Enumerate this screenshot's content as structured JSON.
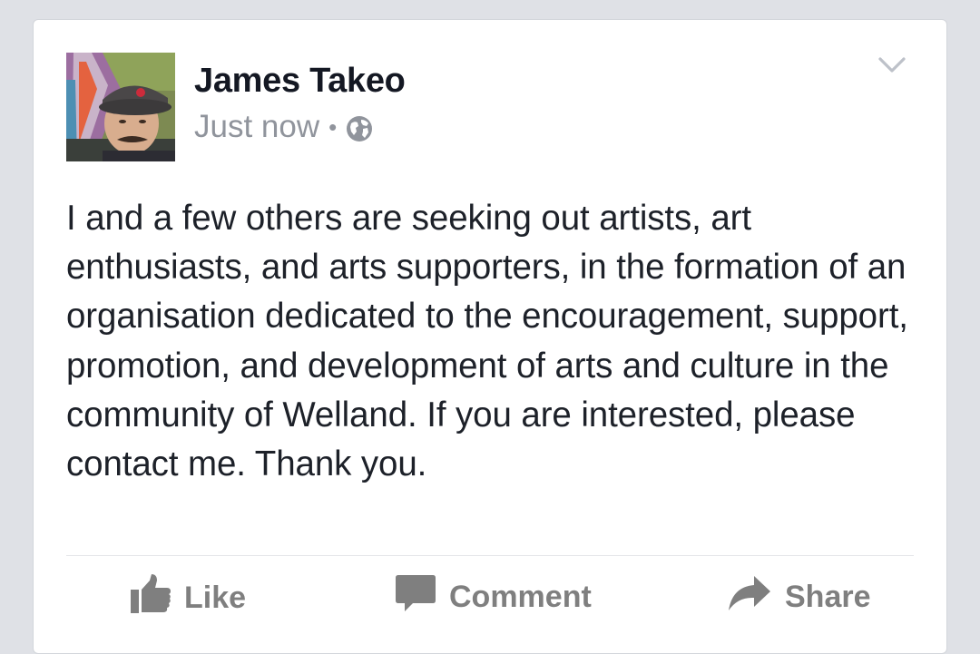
{
  "post": {
    "author_name": "James Takeo",
    "timestamp": "Just now",
    "separator": "•",
    "privacy_icon": "globe-icon",
    "menu_icon": "chevron-down-icon",
    "avatar_icon": "profile-photo",
    "text": "I and a few others are seeking out artists, art enthusiasts, and arts supporters, in the formation of an organisation dedicated to the encouragement, support, promotion, and development of arts and culture in the community of Welland. If you are interested, please contact me. Thank you."
  },
  "actions": {
    "like_label": "Like",
    "like_icon": "thumbs-up-icon",
    "comment_label": "Comment",
    "comment_icon": "speech-bubble-icon",
    "share_label": "Share",
    "share_icon": "share-arrow-icon"
  },
  "colors": {
    "page_background": "#dfe1e6",
    "card_background": "#ffffff",
    "author_text": "#141823",
    "meta_text": "#90949c",
    "body_text": "#1d2129",
    "action_text": "#7f7f7f"
  }
}
